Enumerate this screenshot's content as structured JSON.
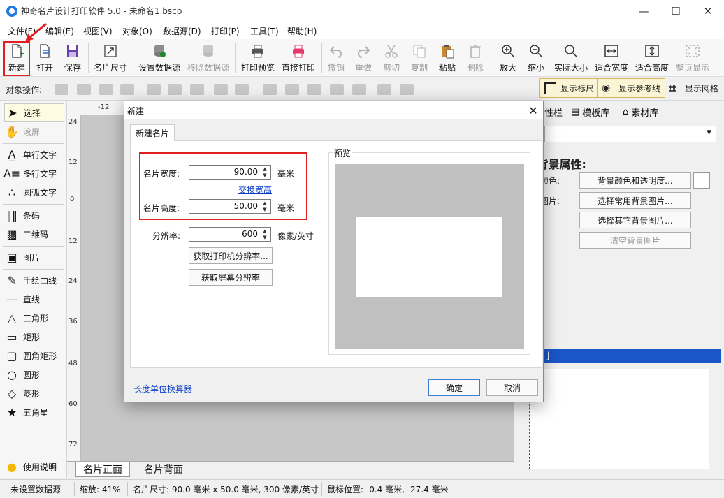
{
  "window": {
    "title": "神奇名片设计打印软件 5.0 - 未命名1.bscp"
  },
  "menu": [
    "文件(F)",
    "编辑(E)",
    "视图(V)",
    "对象(O)",
    "数据源(D)",
    "打印(P)",
    "工具(T)",
    "帮助(H)"
  ],
  "toolbar": {
    "new": "新建",
    "open": "打开",
    "save": "保存",
    "card_size": "名片尺寸",
    "set_datasource": "设置数据源",
    "remove_datasource": "移除数据源",
    "print_preview": "打印预览",
    "direct_print": "直接打印",
    "undo": "撤销",
    "redo": "重做",
    "cut": "剪切",
    "copy": "复制",
    "paste": "粘贴",
    "delete": "删除",
    "zoom_in": "放大",
    "zoom_out": "缩小",
    "actual_size": "实际大小",
    "fit_width": "适合宽度",
    "fit_height": "适合高度",
    "full_page": "整页显示"
  },
  "objbar": {
    "label": "对象操作:",
    "show_ruler": "显示标尺",
    "show_guides": "显示参考线",
    "show_grid": "显示网格"
  },
  "left_tools": {
    "select": "选择",
    "scroll": "滚屏",
    "single_text": "单行文字",
    "multi_text": "多行文字",
    "arc_text": "圆弧文字",
    "barcode": "条码",
    "qrcode": "二维码",
    "image": "图片",
    "freehand": "手绘曲线",
    "line": "直线",
    "triangle": "三角形",
    "rectangle": "矩形",
    "rounded_rect": "圆角矩形",
    "circle": "圆形",
    "diamond": "菱形",
    "star": "五角星",
    "help": "使用说明"
  },
  "ruler": {
    "h": [
      "-12"
    ],
    "v": [
      "24",
      "12",
      "0",
      "12",
      "24",
      "36",
      "48",
      "60",
      "72"
    ]
  },
  "bottom_tabs": {
    "front": "名片正面",
    "back": "名片背面"
  },
  "right_panel": {
    "tab_props": "性栏",
    "tab_templates": "模板库",
    "tab_assets": "素材库",
    "heading": "i背景属性:",
    "color_label": "颜色:",
    "image_label": "图片:",
    "btn_color": "背景颜色和透明度...",
    "btn_common_img": "选择常用背景图片...",
    "btn_other_img": "选择其它背景图片...",
    "btn_clear_img": "清空背景图片",
    "blue_bar_text": "j"
  },
  "status": {
    "datasource": "未设置数据源",
    "zoom": "缩放: 41%",
    "card_size": "名片尺寸: 90.0 毫米 x 50.0 毫米, 300 像素/英寸",
    "mouse": "鼠标位置: -0.4 毫米, -27.4 毫米"
  },
  "dialog": {
    "title": "新建",
    "tab": "新建名片",
    "width_label": "名片宽度:",
    "width_value": "90.00",
    "width_unit": "毫米",
    "swap_link": "交换宽高",
    "height_label": "名片高度:",
    "height_value": "50.00",
    "height_unit": "毫米",
    "dpi_label": "分辨率:",
    "dpi_value": "600",
    "dpi_unit": "像素/英寸",
    "btn_printer_dpi": "获取打印机分辨率...",
    "btn_screen_dpi": "获取屏幕分辨率",
    "preview_label": "预览",
    "unit_calc_link": "长度单位换算器",
    "ok": "确定",
    "cancel": "取消"
  },
  "colors": {
    "accent_red": "#e02020",
    "link_blue": "#0a3dc8",
    "header_blue": "#1a56c8"
  }
}
